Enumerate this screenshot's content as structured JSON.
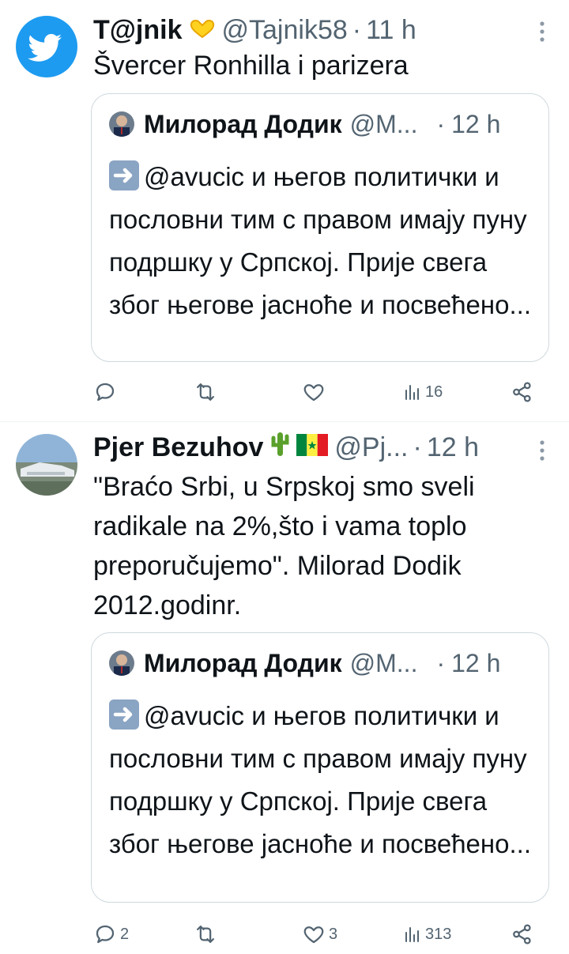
{
  "tweets": [
    {
      "name": "T@jnik",
      "handle": "@Tajnik58",
      "separator": "·",
      "time": "11 h",
      "avatar": "twitter-bird-avatar",
      "text": "Švercer Ronhilla i parizera",
      "quote": {
        "name": "Милорад Додик",
        "handle": "@M...",
        "separator": "·",
        "time": "12 h",
        "text": "@avucic и његов политички и пословни тим с правом имају пуну подршку у Српској. Прије свега због његове јасноће и посвећено..."
      },
      "actions": {
        "reply_count": "",
        "retweet_count": "",
        "like_count": "",
        "views": "16"
      }
    },
    {
      "name": "Pjer Bezuhov",
      "handle": "@Pj...",
      "separator": "·",
      "time": "12 h",
      "emojis": [
        "cactus-emoji",
        "senegal-flag-emoji"
      ],
      "text": "\"Braćo Srbi, u Srpskoj smo sveli radikale na 2%,što i vama toplo preporučujemo\". Milorad Dodik 2012.godinr.",
      "quote": {
        "name": "Милорад Додик",
        "handle": "@M...",
        "separator": "·",
        "time": "12 h",
        "text": "@avucic и његов политички и пословни тим с правом имају пуну подршку у Српској. Прије свега због његове јасноће и посвећено..."
      },
      "actions": {
        "reply_count": "2",
        "retweet_count": "",
        "like_count": "3",
        "views": "313"
      }
    }
  ],
  "colors": {
    "text": "#0f1419",
    "muted": "#536471",
    "border": "#cfd9de",
    "twitter_blue": "#1d9bf0"
  }
}
